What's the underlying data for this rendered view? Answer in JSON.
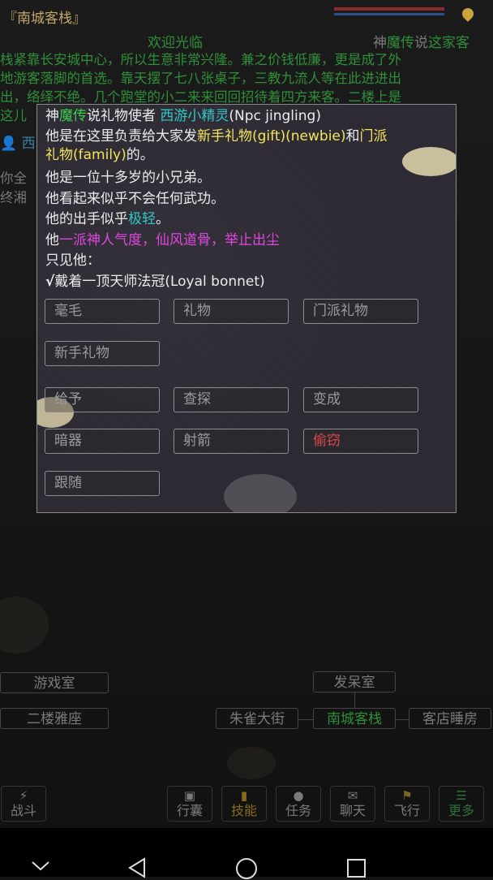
{
  "room": {
    "title": "『南城客栈』",
    "welcome": "欢迎光临",
    "legend_prefix": "神",
    "legend_mid": "魔传",
    "legend_suffix": "说",
    "desc_line_1": "这家客",
    "desc_line_2": "栈紧靠长安城中心，所以生意非常兴隆。兼之价钱低廉，更是成了外",
    "desc_line_3": "地游客落脚的首选。靠天摆了七八张桌子，三教九流人等在此进进出",
    "desc_line_4": "出，络绎不绝。几个跑堂的小二来来回回招待着四方来客。二楼上是",
    "desc_line_5": "这儿",
    "side_person": "西",
    "side_text_1": "你全",
    "side_text_2": "终湘"
  },
  "dialog": {
    "line1": {
      "a": "神",
      "b": "魔传",
      "c": "说",
      "d": "礼物使者 ",
      "e": "西游小精灵",
      "f": "(Npc jingling)"
    },
    "line2": {
      "a": "他是在这里负责给大家发",
      "b": "新手礼物(gift)(newbie)",
      "c": "和",
      "d": "门派"
    },
    "line3": {
      "a": "礼物(family)",
      "b": "的。"
    },
    "line4": "他是一位十多岁的小兄弟。",
    "line5": "他看起来似乎不会任何武功。",
    "line6": {
      "a": "他的出手似乎",
      "b": "极轻",
      "c": "。"
    },
    "line7": {
      "a": "他",
      "b": "一派神人气度，仙风道骨，举止出尘"
    },
    "line8": "只见他：",
    "line9": {
      "check": "√",
      "text": "戴着一顶天师法冠(Loyal bonnet)"
    },
    "buttons": {
      "b1": "毫毛",
      "b2": "礼物",
      "b3": "门派礼物",
      "b4": "新手礼物",
      "b5": "给予",
      "b6": "查探",
      "b7": "变成",
      "b8": "暗器",
      "b9": "射箭",
      "b10": "偷窃",
      "b11": "跟随"
    }
  },
  "map": {
    "game_room": "游戏室",
    "upstairs": "二楼雅座",
    "daze_room": "发呆室",
    "street": "朱雀大街",
    "current": "南城客栈",
    "inn_bedroom": "客店睡房"
  },
  "nav": {
    "fight": "战斗",
    "bag": "行囊",
    "skill": "技能",
    "task": "任务",
    "chat": "聊天",
    "fly": "飞行",
    "more": "更多"
  },
  "colors": {
    "green": "#3ad14a",
    "yellow": "#f3e55a",
    "cyan": "#31c7c7",
    "magenta": "#e046e0",
    "red": "#e04848"
  }
}
